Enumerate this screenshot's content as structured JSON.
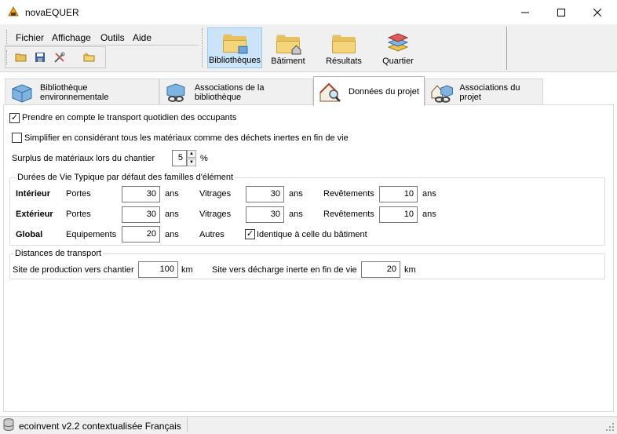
{
  "window": {
    "title": "novaEQUER"
  },
  "menu": {
    "items": [
      "Fichier",
      "Affichage",
      "Outils",
      "Aide"
    ]
  },
  "toolbar": {
    "big_buttons": [
      {
        "label": "Bibliothèques",
        "active": true
      },
      {
        "label": "Bâtiment",
        "active": false
      },
      {
        "label": "Résultats",
        "active": false
      },
      {
        "label": "Quartier",
        "active": false
      }
    ]
  },
  "tabs": [
    {
      "label": "Bibliothèque environnementale",
      "active": false
    },
    {
      "label": "Associations de la bibliothèque",
      "active": false
    },
    {
      "label": "Données du projet",
      "active": true
    },
    {
      "label": "Associations du projet",
      "active": false
    }
  ],
  "options": {
    "transport_label": "Prendre en compte le transport quotidien des occupants",
    "transport_checked": true,
    "inert_label": "Simplifier en considérant tous les matériaux comme des déchets inertes en fin de vie",
    "inert_checked": false,
    "surplus_label": "Surplus de matériaux lors du chantier",
    "surplus_value": "5",
    "surplus_unit": "%"
  },
  "lifespans": {
    "title": "Durées de Vie Typique par défaut des familles d'élément",
    "unit": "ans",
    "rows": {
      "interior": {
        "label": "Intérieur",
        "portes_label": "Portes",
        "portes": "30",
        "vitrages_label": "Vitrages",
        "vitrages": "30",
        "revetements_label": "Revêtements",
        "revetements": "10"
      },
      "exterior": {
        "label": "Extérieur",
        "portes_label": "Portes",
        "portes": "30",
        "vitrages_label": "Vitrages",
        "vitrages": "30",
        "revetements_label": "Revêtements",
        "revetements": "10"
      },
      "global": {
        "label": "Global",
        "equip_label": "Equipements",
        "equip": "20",
        "autres_label": "Autres",
        "identique_label": "Identique à celle du bâtiment",
        "identique_checked": true
      }
    }
  },
  "distances": {
    "title": "Distances de transport",
    "production_label": "Site de production vers chantier",
    "production_value": "100",
    "decharge_label": "Site vers décharge inerte en fin de vie",
    "decharge_value": "20",
    "unit": "km"
  },
  "status": {
    "text": "ecoinvent v2.2 contextualisée Français"
  }
}
